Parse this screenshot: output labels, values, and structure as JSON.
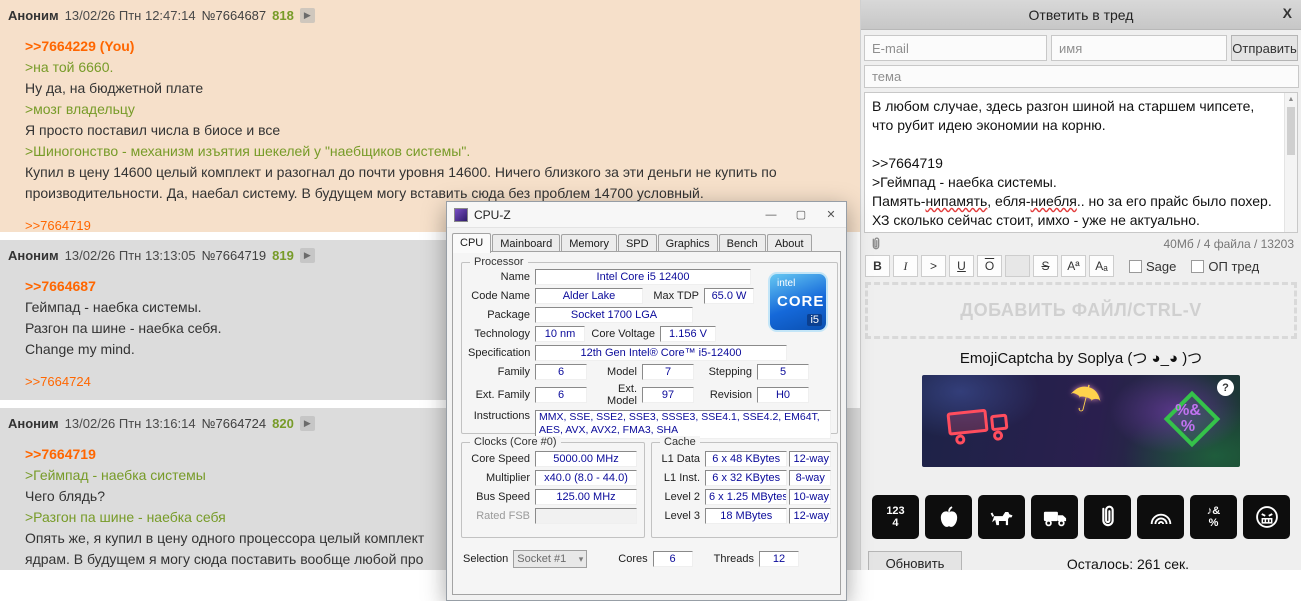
{
  "icons": {
    "expand": "▶",
    "minimize": "—",
    "maximize": "▢",
    "close": "✕",
    "close_form": "X",
    "scroll_up": "▲",
    "dropdown": "▾",
    "help": "?",
    "umbrella": "☂",
    "percent_top": "%&",
    "percent_bottom": "%"
  },
  "thread": {
    "posts": [
      {
        "header": {
          "name": "Аноним",
          "date": "13/02/26 Птн 12:47:14",
          "number": "№7664687",
          "ordinal": "818"
        },
        "lines": [
          {
            "type": "reply-link",
            "text": ">>7664229 (You)"
          },
          {
            "type": "quote",
            "text": ">на той 6660."
          },
          {
            "type": "text",
            "text": "Ну да, на бюджетной плате"
          },
          {
            "type": "quote",
            "text": ">мозг владельцу"
          },
          {
            "type": "text",
            "text": "Я просто поставил числа в биосе и все"
          },
          {
            "type": "quote",
            "text": ">Шиногонство - механизм изъятия шекелей у \"наебщиков системы\"."
          },
          {
            "type": "text",
            "text": "Купил в цену 14600 целый комплект и разогнал до почти уровня 14600. Ничего близкого за эти деньги не купить по производительности. Да, наебал систему. В будущем могу вставить сюда без проблем 14700 условный."
          }
        ],
        "replies": [
          ">>7664719"
        ]
      },
      {
        "header": {
          "name": "Аноним",
          "date": "13/02/26 Птн 13:13:05",
          "number": "№7664719",
          "ordinal": "819"
        },
        "lines": [
          {
            "type": "reply-link",
            "text": ">>7664687"
          },
          {
            "type": "text",
            "text": "Геймпад - наебка системы."
          },
          {
            "type": "text",
            "text": "Разгон па шине - наебка себя."
          },
          {
            "type": "text",
            "text": "Change my mind."
          }
        ],
        "replies": [
          ">>7664724"
        ]
      },
      {
        "header": {
          "name": "Аноним",
          "date": "13/02/26 Птн 13:16:14",
          "number": "№7664724",
          "ordinal": "820"
        },
        "lines": [
          {
            "type": "reply-link",
            "text": ">>7664719"
          },
          {
            "type": "quote",
            "text": ">Геймпад - наебка системы"
          },
          {
            "type": "text",
            "text": "Чего блядь?"
          },
          {
            "type": "quote",
            "text": ">Разгон па шине - наебка себя"
          },
          {
            "type": "text",
            "text": "Опять же, я купил в цену одного процессора целый комплект"
          },
          {
            "type": "text",
            "text": "ядрам. В будущем я могу сюда поставить вообще любой про"
          }
        ],
        "replies": []
      }
    ]
  },
  "cpuz": {
    "title": "CPU-Z",
    "tabs": [
      "CPU",
      "Mainboard",
      "Memory",
      "SPD",
      "Graphics",
      "Bench",
      "About"
    ],
    "active_tab": "CPU",
    "processor": {
      "group_label": "Processor",
      "name_label": "Name",
      "name": "Intel Core i5 12400",
      "code_name_label": "Code Name",
      "code_name": "Alder Lake",
      "max_tdp_label": "Max TDP",
      "max_tdp": "65.0 W",
      "package_label": "Package",
      "package": "Socket 1700 LGA",
      "technology_label": "Technology",
      "technology": "10 nm",
      "core_voltage_label": "Core Voltage",
      "core_voltage": "1.156 V",
      "specification_label": "Specification",
      "specification": "12th Gen Intel® Core™ i5-12400",
      "family_label": "Family",
      "family": "6",
      "model_label": "Model",
      "model": "7",
      "stepping_label": "Stepping",
      "stepping": "5",
      "ext_family_label": "Ext. Family",
      "ext_family": "6",
      "ext_model_label": "Ext. Model",
      "ext_model": "97",
      "revision_label": "Revision",
      "revision": "H0",
      "instructions_label": "Instructions",
      "instructions": "MMX, SSE, SSE2, SSE3, SSSE3, SSE4.1, SSE4.2, EM64T, AES, AVX, AVX2, FMA3, SHA",
      "badge": {
        "brand": "intel",
        "line": "CORE",
        "model": "i5"
      }
    },
    "clocks": {
      "group_label": "Clocks (Core #0)",
      "core_speed_label": "Core Speed",
      "core_speed": "5000.00 MHz",
      "multiplier_label": "Multiplier",
      "multiplier": "x40.0 (8.0 - 44.0)",
      "bus_speed_label": "Bus Speed",
      "bus_speed": "125.00 MHz",
      "rated_fsb_label": "Rated FSB",
      "rated_fsb": ""
    },
    "cache": {
      "group_label": "Cache",
      "rows": [
        {
          "label": "L1 Data",
          "size": "6 x 48 KBytes",
          "ways": "12-way"
        },
        {
          "label": "L1 Inst.",
          "size": "6 x 32 KBytes",
          "ways": "8-way"
        },
        {
          "label": "Level 2",
          "size": "6 x 1.25 MBytes",
          "ways": "10-way"
        },
        {
          "label": "Level 3",
          "size": "18 MBytes",
          "ways": "12-way"
        }
      ]
    },
    "footer": {
      "selection_label": "Selection",
      "selection": "Socket #1",
      "cores_label": "Cores",
      "cores": "6",
      "threads_label": "Threads",
      "threads": "12"
    }
  },
  "reply_form": {
    "title": "Ответить в тред",
    "email_placeholder": "E-mail",
    "name_placeholder": "имя",
    "submit_label": "Отправить",
    "subject_placeholder": "тема",
    "comment": {
      "line1": "В любом случае, здесь разгон шиной на старшем чипсете, что рубит идею экономии на корню.",
      "line3": ">>7664719",
      "line4": ">Геймпад - наебка системы.",
      "line5_seg1": "Память-",
      "line5_seg2": "нипамять",
      "line5_seg3": ", ебля-",
      "line5_seg4": "ниебля",
      "line5_seg5": ".. но за его прайс было похер. ХЗ сколько сейчас стоит, имхо - уже не актуально."
    },
    "file_limits": "40Мб / 4 файла / 13203",
    "format": {
      "bold": "B",
      "italic": "I",
      "quote": ">",
      "underline": "U",
      "overline": "O",
      "spoiler": "",
      "strike": "S",
      "sup": "Aª",
      "sub": "Aₐ"
    },
    "sage_label": "Sage",
    "op_label": "ОП тред",
    "dropzone_label": "ДОБАВИТЬ ФАЙЛ/CTRL-V",
    "captcha": {
      "title": "EmojiCaptcha by Soplya (つ ◕_◕ )つ",
      "options": [
        "numbers-1234",
        "apple",
        "dog",
        "truck",
        "paperclip",
        "rainbow",
        "symbols",
        "angry-mask"
      ],
      "numbers_top": "123",
      "numbers_bottom": "4",
      "symbols_top": "♪&",
      "symbols_bottom": "%"
    },
    "refresh_label": "Обновить",
    "timer_text": "Осталось: 261 сек."
  }
}
